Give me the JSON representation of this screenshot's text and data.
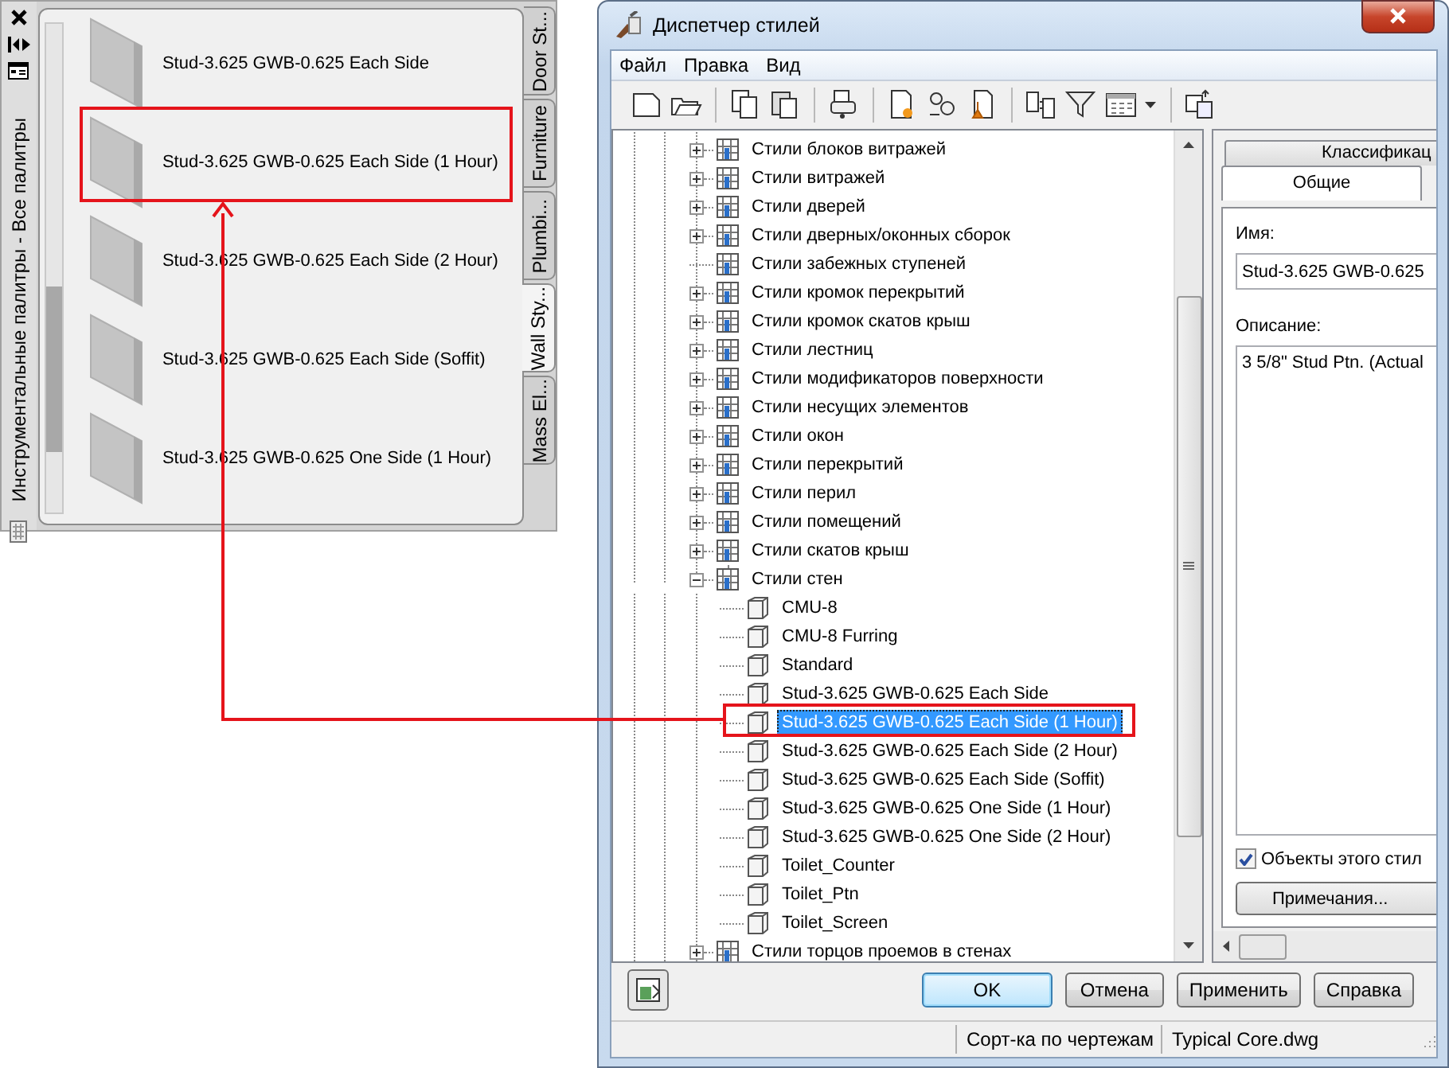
{
  "tool_palette": {
    "title": "Инструментальные палитры - Все палитры",
    "items": [
      {
        "label": "Stud-3.625 GWB-0.625 Each Side"
      },
      {
        "label": "Stud-3.625 GWB-0.625 Each Side (1 Hour)"
      },
      {
        "label": "Stud-3.625 GWB-0.625 Each Side (2 Hour)"
      },
      {
        "label": "Stud-3.625 GWB-0.625 Each Side (Soffit)"
      },
      {
        "label": "Stud-3.625 GWB-0.625 One Side (1 Hour)"
      }
    ],
    "tabs": [
      {
        "label": "Door St...",
        "selected": false
      },
      {
        "label": "Furniture",
        "selected": false
      },
      {
        "label": "Plumbi...",
        "selected": false
      },
      {
        "label": "Wall Sty...",
        "selected": true
      },
      {
        "label": "Mass El...",
        "selected": false
      }
    ]
  },
  "style_manager": {
    "title": "Диспетчер стилей",
    "menu": [
      "Файл",
      "Правка",
      "Вид"
    ],
    "tree": [
      {
        "label": "Стили блоков витражей",
        "has_children": true,
        "expanded": false
      },
      {
        "label": "Стили витражей",
        "has_children": true,
        "expanded": false
      },
      {
        "label": "Стили дверей",
        "has_children": true,
        "expanded": false
      },
      {
        "label": "Стили дверных/оконных сборок",
        "has_children": true,
        "expanded": false
      },
      {
        "label": "Стили забежных ступеней",
        "has_children": false,
        "expanded": false
      },
      {
        "label": "Стили кромок перекрытий",
        "has_children": true,
        "expanded": false
      },
      {
        "label": "Стили кромок скатов крыш",
        "has_children": true,
        "expanded": false
      },
      {
        "label": "Стили лестниц",
        "has_children": true,
        "expanded": false
      },
      {
        "label": "Стили модификаторов поверхности",
        "has_children": true,
        "expanded": false
      },
      {
        "label": "Стили несущих элементов",
        "has_children": true,
        "expanded": false
      },
      {
        "label": "Стили окон",
        "has_children": true,
        "expanded": false
      },
      {
        "label": "Стили перекрытий",
        "has_children": true,
        "expanded": false
      },
      {
        "label": "Стили перил",
        "has_children": true,
        "expanded": false
      },
      {
        "label": "Стили помещений",
        "has_children": true,
        "expanded": false
      },
      {
        "label": "Стили скатов крыш",
        "has_children": true,
        "expanded": false
      },
      {
        "label": "Стили стен",
        "has_children": true,
        "expanded": true,
        "children": [
          {
            "label": "CMU-8",
            "selected": false
          },
          {
            "label": "CMU-8 Furring",
            "selected": false
          },
          {
            "label": "Standard",
            "selected": false
          },
          {
            "label": "Stud-3.625 GWB-0.625 Each Side",
            "selected": false
          },
          {
            "label": "Stud-3.625 GWB-0.625 Each Side (1 Hour)",
            "selected": true
          },
          {
            "label": "Stud-3.625 GWB-0.625 Each Side (2 Hour)",
            "selected": false
          },
          {
            "label": "Stud-3.625 GWB-0.625 Each Side (Soffit)",
            "selected": false
          },
          {
            "label": "Stud-3.625 GWB-0.625 One Side (1 Hour)",
            "selected": false
          },
          {
            "label": "Stud-3.625 GWB-0.625 One Side (2 Hour)",
            "selected": false
          },
          {
            "label": "Toilet_Counter",
            "selected": false
          },
          {
            "label": "Toilet_Ptn",
            "selected": false
          },
          {
            "label": "Toilet_Screen",
            "selected": false
          }
        ]
      },
      {
        "label": "Стили торцов проемов в стенах",
        "has_children": true,
        "expanded": false
      }
    ],
    "tabs": [
      {
        "label": "Классификац",
        "selected": false
      },
      {
        "label": "Общие",
        "selected": true
      }
    ],
    "name_label": "Имя:",
    "name_value": "Stud-3.625 GWB-0.625",
    "description_label": "Описание:",
    "description_value": "3 5/8\" Stud Ptn. (Actual",
    "checkbox": {
      "label": "Объекты этого стил",
      "checked": true
    },
    "notes_button": "Примечания...",
    "buttons": [
      "OK",
      "Отмена",
      "Применить",
      "Справка"
    ],
    "status_bar": [
      "Сорт-ка по чертежам",
      "Typical Core.dwg"
    ]
  }
}
